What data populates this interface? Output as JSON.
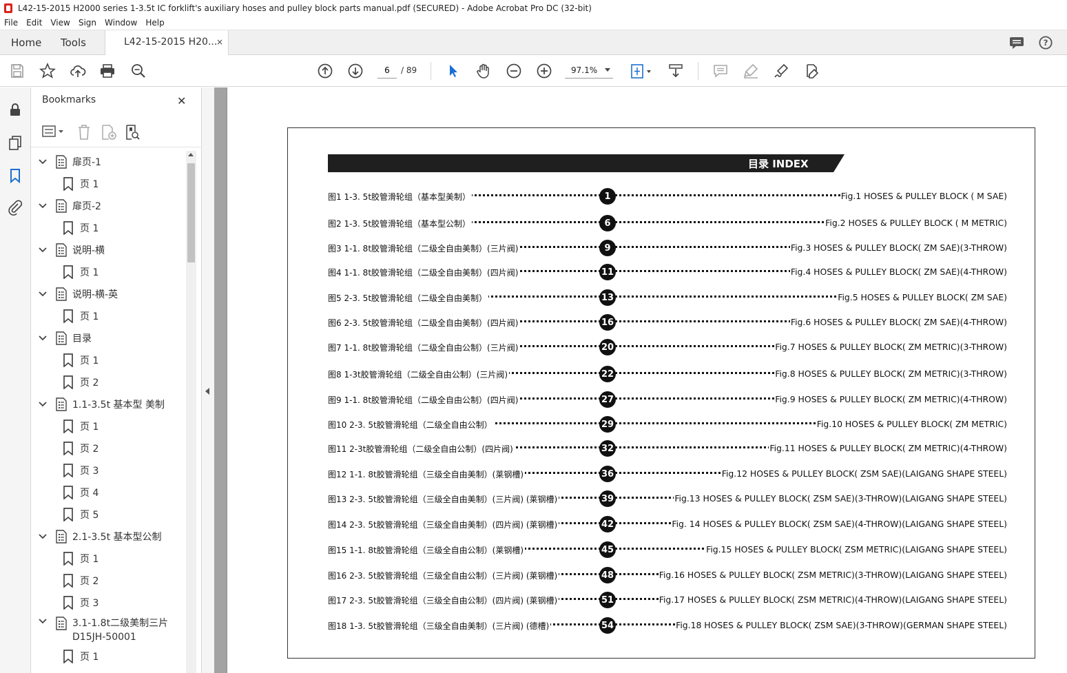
{
  "window": {
    "title": "L42-15-2015 H2000 series 1-3.5t IC forklift's auxiliary hoses and pulley block parts manual.pdf (SECURED) - Adobe Acrobat Pro DC (32-bit)"
  },
  "menu": [
    "File",
    "Edit",
    "View",
    "Sign",
    "Window",
    "Help"
  ],
  "tabs": {
    "home": "Home",
    "tools": "Tools",
    "doc": "L42-15-2015 H20...",
    "close": "×"
  },
  "toolbar": {
    "page_current": "6",
    "page_total": "/ 89",
    "zoom": "97.1%"
  },
  "bookmarks": {
    "title": "Bookmarks",
    "close": "✕",
    "items": [
      {
        "label": "扉页-1",
        "level": 1
      },
      {
        "label": "页 1",
        "level": 2
      },
      {
        "label": "扉页-2",
        "level": 1
      },
      {
        "label": "页 1",
        "level": 2
      },
      {
        "label": "说明-横",
        "level": 1
      },
      {
        "label": "页 1",
        "level": 2
      },
      {
        "label": "说明-横-英",
        "level": 1
      },
      {
        "label": "页 1",
        "level": 2
      },
      {
        "label": "目录",
        "level": 1
      },
      {
        "label": "页 1",
        "level": 2
      },
      {
        "label": "页 2",
        "level": 2
      },
      {
        "label": "1.1-3.5t 基本型 美制",
        "level": 1
      },
      {
        "label": "页 1",
        "level": 2
      },
      {
        "label": "页 2",
        "level": 2
      },
      {
        "label": "页 3",
        "level": 2
      },
      {
        "label": "页 4",
        "level": 2
      },
      {
        "label": "页 5",
        "level": 2
      },
      {
        "label": "2.1-3.5t 基本型公制",
        "level": 1
      },
      {
        "label": "页 1",
        "level": 2
      },
      {
        "label": "页 2",
        "level": 2
      },
      {
        "label": "页 3",
        "level": 2
      },
      {
        "label": "3.1-1.8t二级美制三片",
        "level": 1,
        "line2": "D15JH-50001"
      },
      {
        "label": "页 1",
        "level": 2
      }
    ]
  },
  "document": {
    "index_title": "目录 INDEX",
    "entries": [
      {
        "cn": "图1  1-3. 5t胶管滑轮组（基本型美制）",
        "num": "1",
        "en": "Fig.1  HOSES & PULLEY BLOCK ( M SAE)"
      },
      {
        "cn": "图2  1-3. 5t胶管滑轮组（基本型公制）",
        "num": "6",
        "en": "Fig.2 HOSES & PULLEY BLOCK ( M METRIC)"
      },
      {
        "cn": "图3  1-1. 8t胶管滑轮组（二级全自由美制）(三片阀)",
        "num": "9",
        "en": "Fig.3 HOSES & PULLEY BLOCK( ZM SAE)(3-THROW)"
      },
      {
        "cn": "图4  1-1. 8t胶管滑轮组（二级全自由美制）(四片阀)",
        "num": "11",
        "en": "Fig.4 HOSES & PULLEY BLOCK( ZM SAE)(4-THROW)"
      },
      {
        "cn": "图5  2-3. 5t胶管滑轮组（二级全自由美制）",
        "num": "13",
        "en": "Fig.5 HOSES & PULLEY BLOCK( ZM SAE)"
      },
      {
        "cn": "图6  2-3. 5t胶管滑轮组（二级全自由美制）(四片阀)",
        "num": "16",
        "en": "Fig.6 HOSES & PULLEY BLOCK( ZM SAE)(4-THROW)"
      },
      {
        "cn": "图7  1-1. 8t胶管滑轮组（二级全自由公制）(三片阀)",
        "num": "20",
        "en": "Fig.7 HOSES & PULLEY BLOCK( ZM METRIC)(3-THROW)"
      },
      {
        "cn": "图8  1-3t胶管滑轮组（二级全自由公制）(三片阀)",
        "num": "22",
        "en": "Fig.8 HOSES & PULLEY BLOCK( ZM METRIC)(3-THROW)"
      },
      {
        "cn": "图9  1-1. 8t胶管滑轮组（二级全自由公制）(四片阀)",
        "num": "27",
        "en": "Fig.9 HOSES & PULLEY BLOCK( ZM METRIC)(4-THROW)"
      },
      {
        "cn": "图10  2-3. 5t胶管滑轮组（二级全自由公制）",
        "num": "29",
        "en": "Fig.10 HOSES & PULLEY BLOCK( ZM METRIC)"
      },
      {
        "cn": "图11  2-3t胶管滑轮组（二级全自由公制）(四片阀)",
        "num": "32",
        "en": "Fig.11 HOSES & PULLEY BLOCK( ZM METRIC)(4-THROW)"
      },
      {
        "cn": "图12  1-1. 8t胶管滑轮组（三级全自由美制）(莱钢槽)",
        "num": "36",
        "en": "Fig.12 HOSES & PULLEY BLOCK( ZSM SAE)(LAIGANG SHAPE STEEL)"
      },
      {
        "cn": "图13  2-3. 5t胶管滑轮组（三级全自由美制）(三片阀) (莱钢槽)",
        "num": "39",
        "en": "Fig.13 HOSES & PULLEY BLOCK( ZSM SAE)(3-THROW)(LAIGANG SHAPE STEEL)"
      },
      {
        "cn": "图14  2-3. 5t胶管滑轮组（三级全自由美制）(四片阀) (莱钢槽)",
        "num": "42",
        "en": "Fig. 14 HOSES & PULLEY BLOCK( ZSM SAE)(4-THROW)(LAIGANG SHAPE STEEL)"
      },
      {
        "cn": "图15  1-1. 8t胶管滑轮组（三级全自由公制）(莱钢槽)",
        "num": "45",
        "en": "Fig.15 HOSES & PULLEY BLOCK( ZSM METRIC)(LAIGANG SHAPE STEEL)"
      },
      {
        "cn": "图16  2-3. 5t胶管滑轮组（三级全自由公制）(三片阀) (莱钢槽)",
        "num": "48",
        "en": "Fig.16 HOSES & PULLEY BLOCK( ZSM METRIC)(3-THROW)(LAIGANG SHAPE STEEL)"
      },
      {
        "cn": "图17  2-3. 5t胶管滑轮组（三级全自由公制）(四片阀) (莱钢槽)",
        "num": "51",
        "en": "Fig.17 HOSES & PULLEY BLOCK( ZSM METRIC)(4-THROW)(LAIGANG SHAPE STEEL)"
      },
      {
        "cn": "图18  1-3. 5t胶管滑轮组（三级全自由美制）(三片阀) (德槽)",
        "num": "54",
        "en": "Fig.18 HOSES & PULLEY BLOCK( ZSM SAE)(3-THROW)(GERMAN SHAPE STEEL)"
      }
    ]
  }
}
